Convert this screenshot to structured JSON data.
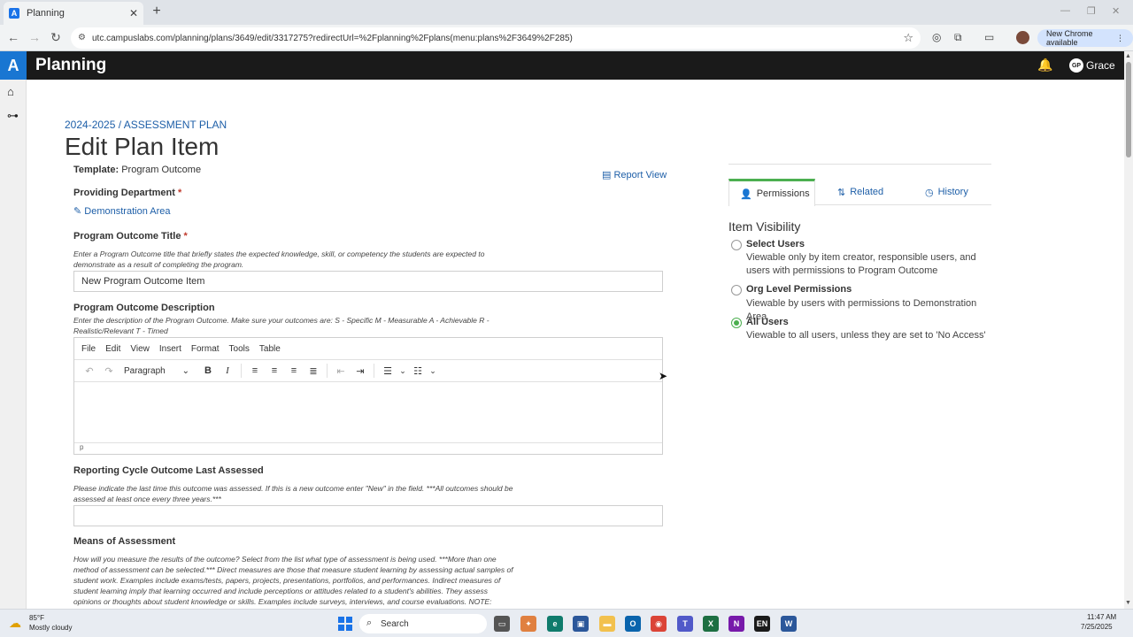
{
  "browser": {
    "tab_title": "Planning",
    "url": "utc.campuslabs.com/planning/plans/3649/edit/3317275?redirectUrl=%2Fplanning%2Fplans(menu:plans%2F3649%2F285)",
    "chrome_available": "New Chrome available"
  },
  "app": {
    "logo_letter": "A",
    "title": "Planning",
    "user_initials": "GP",
    "user_name": "Grace"
  },
  "page": {
    "breadcrumb": "2024-2025 / ASSESSMENT PLAN",
    "title": "Edit Plan Item",
    "template_label": "Template:",
    "template_value": "Program Outcome",
    "report_view": "Report View",
    "providing_dept_label": "Providing Department",
    "required_mark": "*",
    "dept_value": "Demonstration Area",
    "outcome_title_label": "Program Outcome Title",
    "outcome_title_help": "Enter a Program Outcome title that briefly states the expected knowledge, skill, or competency the students are expected to demonstrate as a result of completing the program.",
    "outcome_title_value": "New Program Outcome Item",
    "description_label": "Program Outcome Description",
    "description_help": "Enter the description of the Program Outcome. Make sure your outcomes are: S - Specific M - Measurable A - Achievable R - Realistic/Relevant T - Timed",
    "reporting_label": "Reporting Cycle Outcome Last Assessed",
    "reporting_help": "Please indicate the last time this outcome was assessed. If this is a new outcome enter \"New\" in the field. ***All outcomes should be assessed at least once every three years.***",
    "reporting_value": "",
    "means_label": "Means of Assessment",
    "means_help": "How will you measure the results of the outcome? Select from the list what type of assessment is being used. ***More than one method of assessment can be selected.*** Direct measures are those that measure student learning by assessing actual samples of student work. Examples include exams/tests, papers, projects, presentations, portfolios, and performances. Indirect measures of student learning imply that learning occurred and include perceptions or attitudes related to a student's abilities. They assess opinions or thoughts about student knowledge or skills. Examples include surveys, interviews, and course evaluations. NOTE: Course grades do"
  },
  "editor": {
    "menu": [
      "File",
      "Edit",
      "View",
      "Insert",
      "Format",
      "Tools",
      "Table"
    ],
    "block_format": "Paragraph",
    "status_path": "p"
  },
  "panel": {
    "tabs": {
      "permissions": "Permissions",
      "related": "Related",
      "history": "History"
    },
    "visibility_title": "Item Visibility",
    "options": [
      {
        "title": "Select Users",
        "desc": "Viewable only by item creator, responsible users, and users with permissions to Program Outcome",
        "selected": false
      },
      {
        "title": "Org Level Permissions",
        "desc": "Viewable by users with permissions to Demonstration Area",
        "selected": false
      },
      {
        "title": "All Users",
        "desc": "Viewable to all users, unless they are set to 'No Access'",
        "selected": true
      }
    ],
    "accent_color": "#4caf50"
  },
  "taskbar": {
    "temp": "85°F",
    "weather": "Mostly cloudy",
    "search": "Search",
    "time": "11:47 AM",
    "date": "7/25/2025"
  }
}
